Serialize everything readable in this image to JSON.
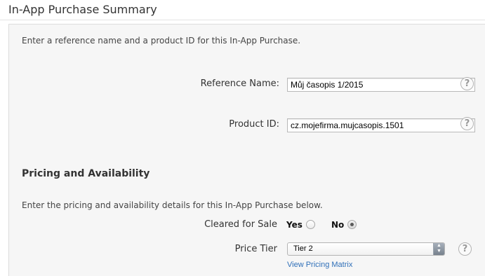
{
  "header": {
    "title": "In-App Purchase Summary"
  },
  "summary": {
    "intro": "Enter a reference name and a product ID for this In-App Purchase.",
    "reference_name": {
      "label": "Reference Name:",
      "value": "Můj časopis 1/2015"
    },
    "product_id": {
      "label": "Product ID:",
      "value": "cz.mojefirma.mujcasopis.1501"
    },
    "help_glyph": "?"
  },
  "pricing": {
    "title": "Pricing and Availability",
    "intro": "Enter the pricing and availability details for this In-App Purchase below.",
    "cleared_for_sale": {
      "label": "Cleared for Sale",
      "yes_label": "Yes",
      "no_label": "No",
      "selected": "No"
    },
    "price_tier": {
      "label": "Price Tier",
      "value": "Tier 2",
      "arrow_up": "▲",
      "arrow_down": "▼"
    },
    "pricing_matrix_link": "View Pricing Matrix"
  },
  "colors": {
    "panel_background": "#f6f6f6",
    "link": "#2f6fb8"
  }
}
